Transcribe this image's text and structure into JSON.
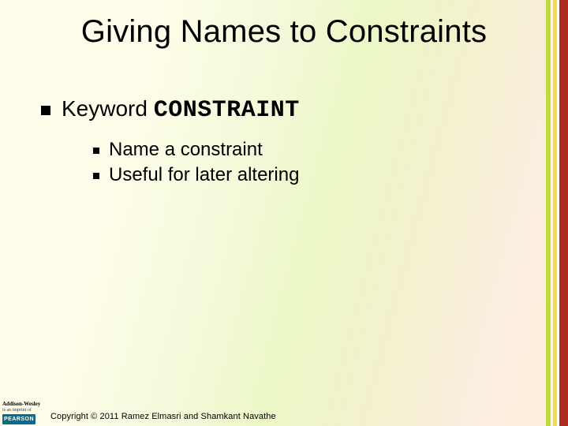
{
  "title": "Giving Names to Constraints",
  "level1": {
    "prefix": "Keyword ",
    "keyword_code": "CONSTRAINT"
  },
  "level2": {
    "items": [
      "Name a constraint",
      "Useful for later altering"
    ]
  },
  "publisher": {
    "imprint_line1": "Addison-Wesley",
    "imprint_line2": "is an imprint of",
    "brand": "PEARSON"
  },
  "copyright": "Copyright © 2011 Ramez Elmasri and Shamkant Navathe"
}
